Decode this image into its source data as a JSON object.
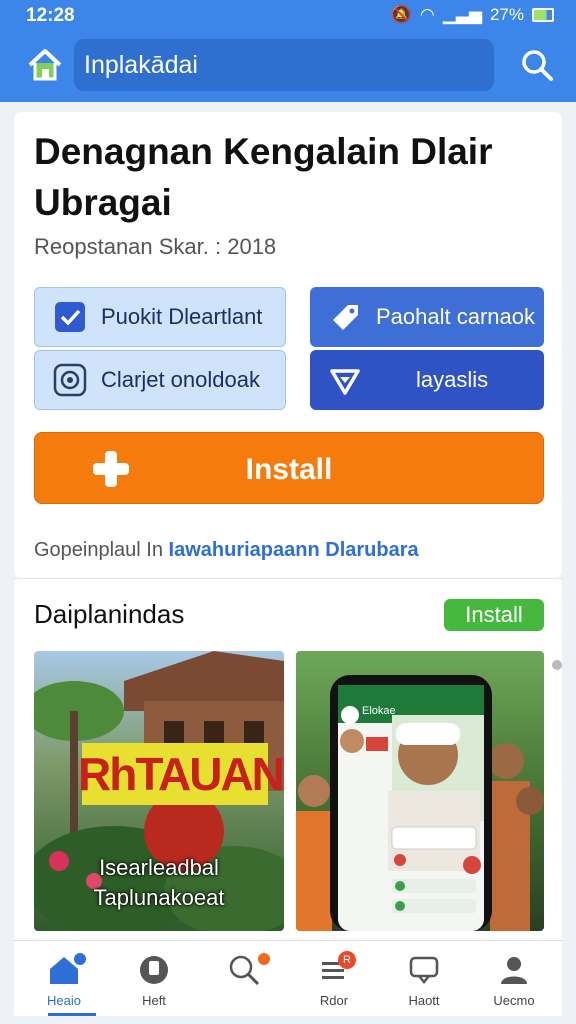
{
  "status_bar": {
    "time": "12:28",
    "battery": "27%"
  },
  "app_bar": {
    "search_value": "Inplakādai"
  },
  "app": {
    "title": "Denagnan Kengalain Dlair Ubragai",
    "subtitle": "Reopstanan Skar. : 2018",
    "chips": [
      {
        "label": "Puokit Dleartlant"
      },
      {
        "label": "Paohalt carnaok"
      },
      {
        "label": "Clarjet onoldoak"
      },
      {
        "label": "layaslis"
      }
    ],
    "install_label": "Install",
    "provider_prefix": "Gopeinplaul In",
    "provider_link": "Iawahuriapaann Dlarubara"
  },
  "section": {
    "title": "Daiplanindas",
    "install_label": "Install",
    "thumbnails": [
      {
        "sign_text": "RhTAUAN",
        "caption_line1": "Isearleadbal",
        "caption_line2": "Taplunakoeat"
      },
      {
        "phone_header": "Elokae"
      }
    ]
  },
  "bottom_nav": [
    {
      "label": "Heaio",
      "icon": "home-icon",
      "active": true
    },
    {
      "label": "Heft",
      "icon": "apps-icon"
    },
    {
      "label": "",
      "icon": "search-icon"
    },
    {
      "label": "Rdor",
      "icon": "list-icon",
      "badge": "R"
    },
    {
      "label": "Haott",
      "icon": "chat-icon"
    },
    {
      "label": "Uecmo",
      "icon": "profile-icon"
    }
  ],
  "colors": {
    "app_bar": "#3b86e8",
    "install_orange": "#f57c0c",
    "install_green": "#46b83e",
    "accent_blue": "#2d6fd4",
    "chip_light": "#cfe3fb",
    "chip_dark": "#3e6fd6"
  }
}
